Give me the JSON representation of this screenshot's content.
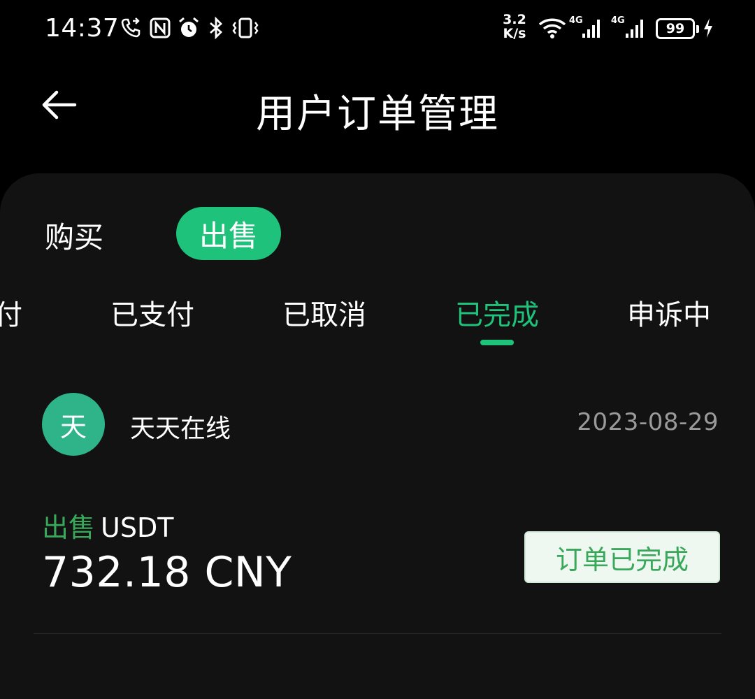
{
  "status_bar": {
    "time": "14:37",
    "net_speed_value": "3.2",
    "net_speed_unit": "K/s",
    "signal_label_1": "4G",
    "signal_label_2": "4G",
    "battery": "99",
    "icons": [
      "call-forward-icon",
      "nfc-icon",
      "alarm-icon",
      "bluetooth-icon",
      "vibrate-icon",
      "wifi-icon",
      "signal-icon",
      "charging-icon"
    ]
  },
  "header": {
    "title": "用户订单管理",
    "back_icon": "back-arrow-icon"
  },
  "type_tabs": [
    {
      "label": "购买",
      "active": false
    },
    {
      "label": "出售",
      "active": true
    }
  ],
  "status_tabs": [
    {
      "label": "付",
      "active": false
    },
    {
      "label": "已支付",
      "active": false
    },
    {
      "label": "已取消",
      "active": false
    },
    {
      "label": "已完成",
      "active": true
    },
    {
      "label": "申诉中",
      "active": false
    }
  ],
  "orders": [
    {
      "avatar_text": "天",
      "merchant": "天天在线",
      "date": "2023-08-29",
      "trade_type": "出售",
      "asset": "USDT",
      "amount": "732.18 CNY",
      "status": "订单已完成"
    }
  ],
  "colors": {
    "accent": "#1ec27a",
    "trade_green": "#3aa85b",
    "background": "#000000",
    "sheet": "#121212",
    "avatar": "#2fb48a",
    "muted_text": "#9a9a9a"
  }
}
